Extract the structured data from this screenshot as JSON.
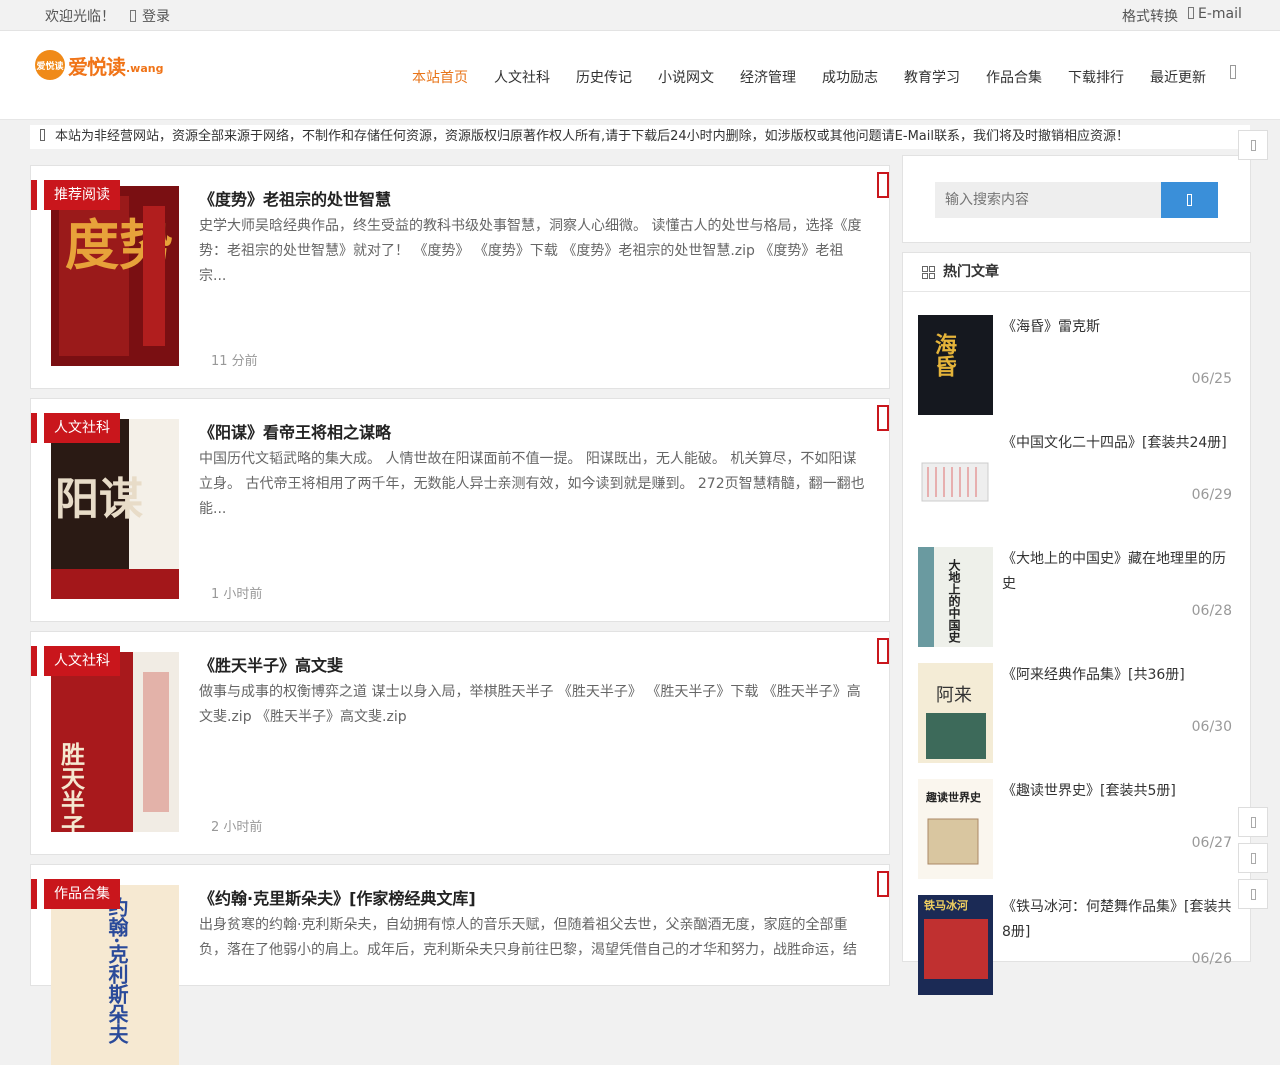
{
  "topbar": {
    "welcome": "欢迎光临！",
    "login": "登录",
    "format": "格式转换",
    "email": "E-mail"
  },
  "logo": {
    "badge": "爱悦读",
    "text": "爱悦读",
    "suffix": ".wang"
  },
  "nav": [
    "本站首页",
    "人文社科",
    "历史传记",
    "小说网文",
    "经济管理",
    "成功励志",
    "教育学习",
    "作品合集",
    "下载排行",
    "最近更新"
  ],
  "notice": "本站为非经营网站，资源全部来源于网络，不制作和存储任何资源，资源版权归原著作权人所有,请于下载后24小时内删除，如涉版权或其他问题请E-Mail联系，我们将及时撤销相应资源！",
  "posts": [
    {
      "tag": "推荐阅读",
      "title": "《度势》老祖宗的处世智慧",
      "excerpt": "史学大师吴晗经典作品，终生受益的教科书级处事智慧，洞察人心细微。 读懂古人的处世与格局，选择《度势：老祖宗的处世智慧》就对了！ 《度势》 《度势》下载 《度势》老祖宗的处世智慧.zip 《度势》老祖宗...",
      "time": "11 分前",
      "cover_text": "度势"
    },
    {
      "tag": "人文社科",
      "title": "《阳谋》看帝王将相之谋略",
      "excerpt": "中国历代文韬武略的集大成。 人情世故在阳谋面前不值一提。 阳谋既出，无人能破。 机关算尽，不如阳谋立身。 古代帝王将相用了两千年，无数能人异士亲测有效，如今读到就是赚到。 272页智慧精髓，翻一翻也能...",
      "time": "1 小时前",
      "cover_text": "阳谋"
    },
    {
      "tag": "人文社科",
      "title": "《胜天半子》高文斐",
      "excerpt": "做事与成事的权衡博弈之道 谋士以身入局，举棋胜天半子 《胜天半子》 《胜天半子》下载 《胜天半子》高文斐.zip 《胜天半子》高文斐.zip",
      "time": "2 小时前",
      "cover_text": "胜天半子"
    },
    {
      "tag": "作品合集",
      "title": "《约翰·克里斯朵夫》[作家榜经典文库]",
      "excerpt": "出身贫寒的约翰·克利斯朵夫，自幼拥有惊人的音乐天赋，但随着祖父去世，父亲酗酒无度，家庭的全部重负，落在了他弱小的肩上。成年后，克利斯朵夫只身前往巴黎，渴望凭借自己的才华和努力，战胜命运，结",
      "time": "",
      "cover_text": "约翰·克利斯朵夫"
    }
  ],
  "sidebar": {
    "search_placeholder": "输入搜索内容",
    "hot_title": "热门文章",
    "hot": [
      {
        "title": "《海昏》雷克斯",
        "date": "06/25",
        "cover": "海昏"
      },
      {
        "title": "《中国文化二十四品》[套装共24册]",
        "date": "06/29",
        "cover": ""
      },
      {
        "title": "《大地上的中国史》藏在地理里的历史",
        "date": "06/28",
        "cover": "大地上的中国史"
      },
      {
        "title": "《阿来经典作品集》[共36册]",
        "date": "06/30",
        "cover": "阿来"
      },
      {
        "title": "《趣读世界史》[套装共5册]",
        "date": "06/27",
        "cover": "趣读世界史"
      },
      {
        "title": "《铁马冰河：何楚舞作品集》[套装共8册]",
        "date": "06/26",
        "cover": "铁马冰河"
      }
    ]
  }
}
